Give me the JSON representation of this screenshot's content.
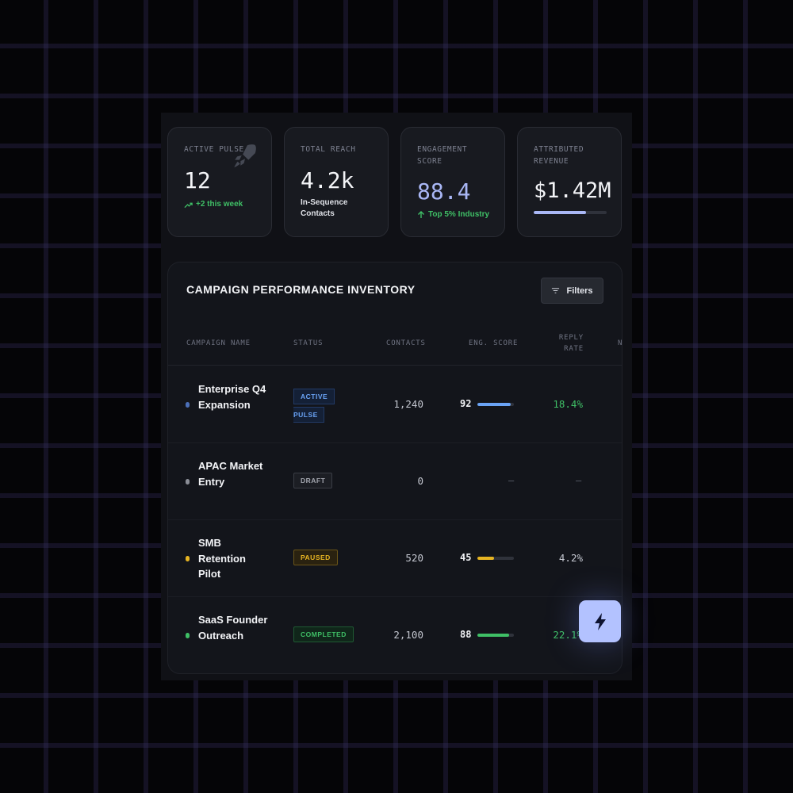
{
  "stats": [
    {
      "label": "ACTIVE PULSE",
      "value": "12",
      "sub": "+2 this week",
      "sub_icon": "trend-up-icon",
      "decor_icon": "rocket-icon"
    },
    {
      "label": "TOTAL REACH",
      "value": "4.2k",
      "sub": "In-Sequence Contacts"
    },
    {
      "label": "ENGAGEMENT SCORE",
      "value": "88.4",
      "sub": "Top 5% Industry",
      "sub_icon": "arrow-up-icon"
    },
    {
      "label": "ATTRIBUTED REVENUE",
      "value": "$1.42M",
      "progress": 0.72
    }
  ],
  "table": {
    "title": "CAMPAIGN PERFORMANCE INVENTORY",
    "filters_label": "Filters",
    "columns": [
      "CAMPAIGN NAME",
      "STATUS",
      "CONTACTS",
      "ENG. SCORE",
      "REPLY RATE",
      "N"
    ],
    "rows": [
      {
        "name": "Enterprise Q4 Expansion",
        "status_line1": "ACTIVE",
        "status_line2": "PULSE",
        "contacts": "1,240",
        "score": "92",
        "score_value": 92,
        "reply": "18.4%"
      },
      {
        "name": "APAC Market Entry",
        "status": "DRAFT",
        "contacts": "0",
        "score": "—",
        "reply": "—"
      },
      {
        "name": "SMB Retention Pilot",
        "status": "PAUSED",
        "contacts": "520",
        "score": "45",
        "score_value": 45,
        "reply": "4.2%"
      },
      {
        "name": "SaaS Founder Outreach",
        "status": "COMPLETED",
        "contacts": "2,100",
        "score": "88",
        "score_value": 88,
        "reply": "22.1%"
      }
    ]
  },
  "colors": {
    "accent_blue": "#6aa3f5",
    "green": "#3fbf66",
    "amber": "#e6b422",
    "gray": "#8a8d96",
    "fab": "#b3c2ff"
  },
  "fab_icon": "lightning-icon"
}
